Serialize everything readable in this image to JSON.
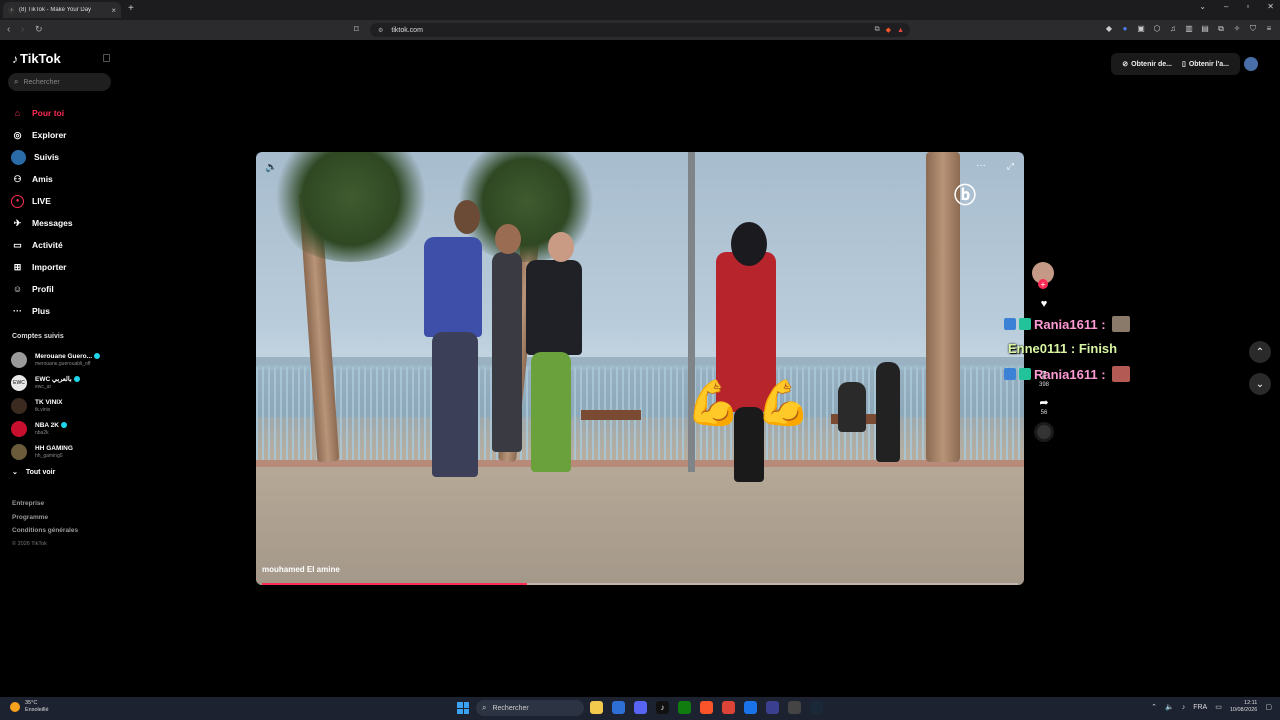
{
  "browser": {
    "tab_title": "(8) TikTok - Make Your Day",
    "url": "tiktok.com"
  },
  "sidebar": {
    "logo": "TikTok",
    "search_placeholder": "Rechercher",
    "nav": [
      {
        "label": "Pour toi",
        "icon": "home-icon"
      },
      {
        "label": "Explorer",
        "icon": "compass-icon"
      },
      {
        "label": "Suivis",
        "icon": "following-icon"
      },
      {
        "label": "Amis",
        "icon": "friends-icon"
      },
      {
        "label": "LIVE",
        "icon": "live-icon"
      },
      {
        "label": "Messages",
        "icon": "messages-icon"
      },
      {
        "label": "Activité",
        "icon": "activity-icon"
      },
      {
        "label": "Importer",
        "icon": "upload-icon"
      },
      {
        "label": "Profil",
        "icon": "profile-icon"
      },
      {
        "label": "Plus",
        "icon": "more-icon"
      }
    ],
    "following_title": "Comptes suivis",
    "following": [
      {
        "name": "Merouane Guero...",
        "handle": "merouane.guerouabli_off",
        "verified": true
      },
      {
        "name": "EWC بالعربي",
        "handle": "ewc_ar",
        "verified": true
      },
      {
        "name": "TK VINIX",
        "handle": "tk.vinix",
        "verified": false
      },
      {
        "name": "NBA 2K",
        "handle": "nba2k",
        "verified": true
      },
      {
        "name": "HH GAMING",
        "handle": "hh_gaming0",
        "verified": false
      }
    ],
    "see_all": "Tout voir",
    "footer": [
      "Entreprise",
      "Programme",
      "Conditions générales"
    ],
    "copyright": "© 2026 TikTok"
  },
  "top_buttons": {
    "get_coins": "Obtenir de...",
    "get_app": "Obtenir l'a..."
  },
  "video": {
    "author": "mouhamed El amine",
    "progress": 0.35
  },
  "actions": {
    "likes": "",
    "bookmarks": "398",
    "shares": "56"
  },
  "chat": [
    {
      "text": "Rania1611 :",
      "color": "#ff9ad5"
    },
    {
      "text": "Enne0111 : Finish",
      "color": "#d8f5a2"
    },
    {
      "text": "Rania1611 :",
      "color": "#ff9ad5"
    }
  ],
  "taskbar": {
    "weather_temp": "35°C",
    "weather_desc": "Ensoleillé",
    "search": "Rechercher",
    "lang": "FRA",
    "time": "12:11",
    "date": "10/08/2026"
  }
}
